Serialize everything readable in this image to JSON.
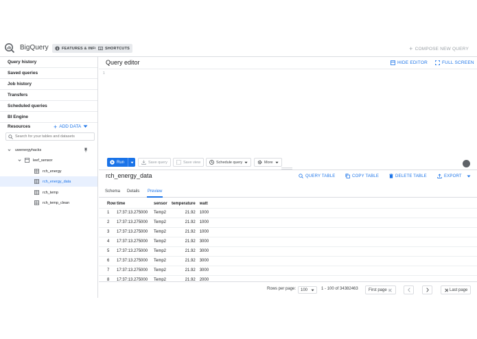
{
  "header": {
    "app_title": "BigQuery",
    "features_label": "FEATURES & INFO",
    "shortcuts_label": "SHORTCUTS",
    "compose_label": "COMPOSE NEW QUERY"
  },
  "sidebar": {
    "nav": [
      "Query history",
      "Saved queries",
      "Job history",
      "Transfers",
      "Scheduled queries",
      "BI Engine"
    ],
    "resources_label": "Resources",
    "add_data_label": "ADD DATA",
    "search_placeholder": "Search for your tables and datasets",
    "project": "uwenergyhacks",
    "dataset": "leef_sensor",
    "tables": [
      "rch_energy",
      "rch_energy_data",
      "rch_temp",
      "rch_temp_clean"
    ],
    "selected_table": "rch_energy_data"
  },
  "editor": {
    "title": "Query editor",
    "hide_editor_label": "HIDE EDITOR",
    "full_screen_label": "FULL SCREEN",
    "line_number": "1"
  },
  "toolbar": {
    "run_label": "Run",
    "save_query_label": "Save query",
    "save_view_label": "Save view",
    "schedule_query_label": "Schedule query",
    "more_label": "More"
  },
  "table_panel": {
    "title": "rch_energy_data",
    "query_table_label": "QUERY TABLE",
    "copy_table_label": "COPY TABLE",
    "delete_table_label": "DELETE TABLE",
    "export_label": "EXPORT",
    "tabs": [
      "Schema",
      "Details",
      "Preview"
    ],
    "active_tab": "Preview"
  },
  "preview": {
    "columns": [
      "Row",
      "time",
      "sensor",
      "temperature",
      "watt"
    ],
    "rows": [
      [
        "1",
        "17:37:13.275000",
        "Temp2",
        "21.92",
        "1000"
      ],
      [
        "2",
        "17:37:13.275000",
        "Temp2",
        "21.92",
        "1000"
      ],
      [
        "3",
        "17:37:13.275000",
        "Temp2",
        "21.92",
        "1000"
      ],
      [
        "4",
        "17:37:13.275000",
        "Temp2",
        "21.92",
        "3000"
      ],
      [
        "5",
        "17:37:13.275000",
        "Temp2",
        "21.92",
        "3000"
      ],
      [
        "6",
        "17:37:13.275000",
        "Temp2",
        "21.92",
        "3000"
      ],
      [
        "7",
        "17:37:13.275000",
        "Temp2",
        "21.92",
        "3000"
      ],
      [
        "8",
        "17:37:13.275000",
        "Temp2",
        "21.92",
        "2000"
      ]
    ]
  },
  "pagination": {
    "rows_per_page_label": "Rows per page:",
    "rows_per_page_value": "100",
    "range_text": "1 - 100 of 34382463",
    "first_page_label": "First page",
    "last_page_label": "Last page"
  },
  "colors": {
    "accent": "#1a73e8",
    "selected_bg": "#e8f0fe",
    "border": "#dadce0"
  }
}
